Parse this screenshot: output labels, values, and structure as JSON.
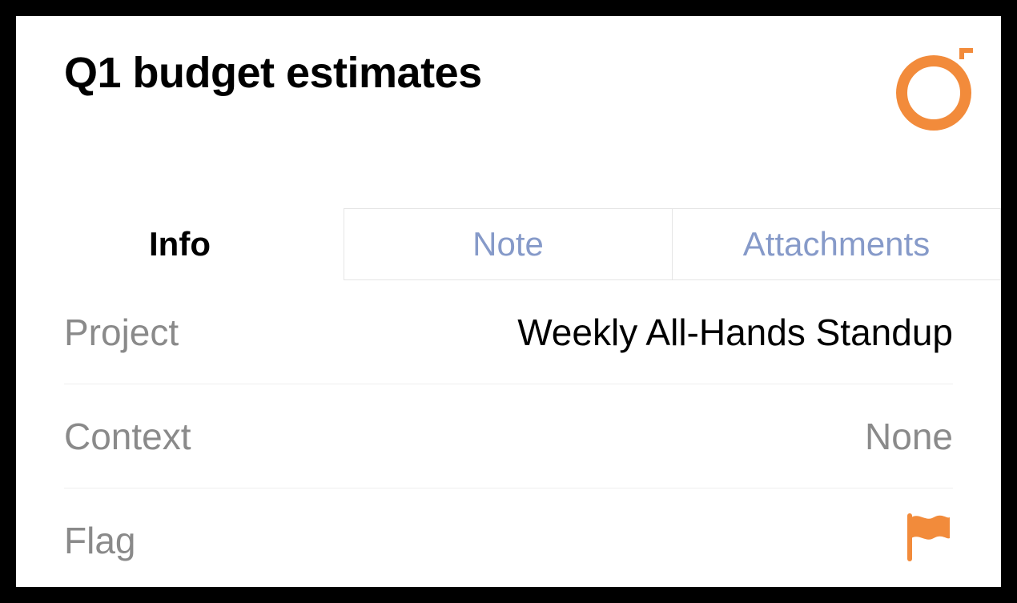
{
  "colors": {
    "accent": "#f28b3b",
    "divider": "#eeeeee",
    "muted": "#8a8a8a",
    "tab_inactive": "#869ac9"
  },
  "header": {
    "title": "Q1 budget estimates"
  },
  "status": {
    "flagged": true,
    "completed": false
  },
  "tabs": [
    {
      "id": "info",
      "label": "Info",
      "active": true
    },
    {
      "id": "note",
      "label": "Note",
      "active": false
    },
    {
      "id": "attachments",
      "label": "Attachments",
      "active": false
    }
  ],
  "info": {
    "project": {
      "label": "Project",
      "value": "Weekly All-Hands Standup"
    },
    "context": {
      "label": "Context",
      "value": "None",
      "is_none": true
    },
    "flag": {
      "label": "Flag",
      "flagged": true
    }
  }
}
